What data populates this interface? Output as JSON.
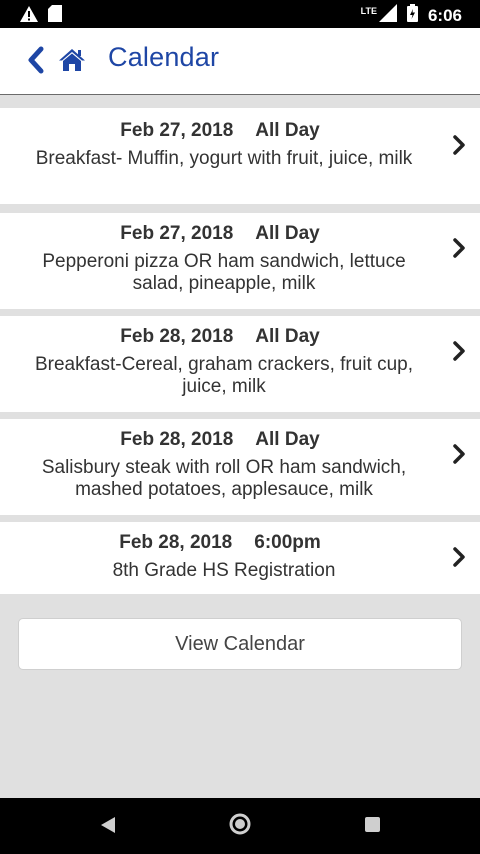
{
  "status_bar": {
    "network": "LTE",
    "time": "6:06"
  },
  "header": {
    "title": "Calendar"
  },
  "events": [
    {
      "date": "Feb 27, 2018",
      "time": "All Day",
      "description": "Breakfast- Muffin, yogurt with fruit, juice, milk"
    },
    {
      "date": "Feb 27, 2018",
      "time": "All Day",
      "description": "Pepperoni pizza OR ham sandwich, lettuce salad, pineapple, milk"
    },
    {
      "date": "Feb 28, 2018",
      "time": "All Day",
      "description": "Breakfast-Cereal, graham crackers, fruit cup, juice, milk"
    },
    {
      "date": "Feb 28, 2018",
      "time": "All Day",
      "description": "Salisbury steak with roll OR ham sandwich, mashed potatoes, applesauce, milk"
    },
    {
      "date": "Feb 28, 2018",
      "time": "6:00pm",
      "description": "8th Grade HS Registration"
    }
  ],
  "view_calendar_button": {
    "label": "View Calendar"
  },
  "colors": {
    "accent": "#1e46a5",
    "background": "#e0e0e0",
    "card": "#ffffff"
  }
}
